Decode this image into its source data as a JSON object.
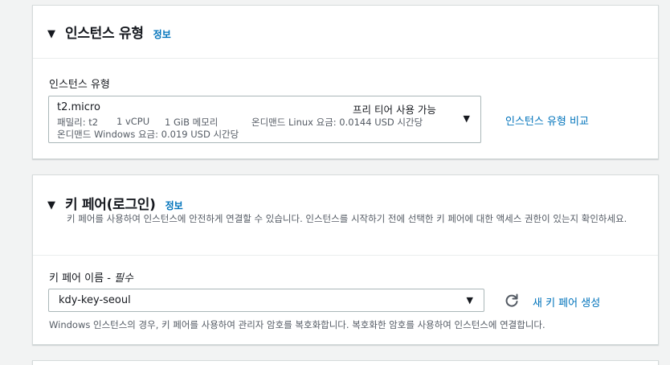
{
  "instance_type_panel": {
    "title": "인스턴스 유형",
    "info": "정보",
    "field_label": "인스턴스 유형",
    "selected": {
      "name": "t2.micro",
      "tag": "프리 티어 사용 가능",
      "family": "패밀리: t2",
      "vcpu": "1 vCPU",
      "memory": "1 GiB 메모리",
      "linux_price": "온디맨드 Linux 요금: 0.0144 USD 시간당",
      "windows_price": "온디맨드 Windows 요금: 0.019 USD 시간당"
    },
    "compare_link": "인스턴스 유형 비교"
  },
  "key_pair_panel": {
    "title": "키 페어(로그인)",
    "info": "정보",
    "description": "키 페어를 사용하여 인스턴스에 안전하게 연결할 수 있습니다. 인스턴스를 시작하기 전에 선택한 키 페어에 대한 액세스 권한이 있는지 확인하세요.",
    "field_label": "키 페어 이름 - ",
    "required": "필수",
    "selected_value": "kdy-key-seoul",
    "create_link": "새 키 페어 생성",
    "help_text": "Windows 인스턴스의 경우, 키 페어를 사용하여 관리자 암호를 복호화합니다. 복호화한 암호를 사용하여 인스턴스에 연결합니다."
  },
  "icons": {
    "expand": "caret-down-icon",
    "dropdown": "caret-down-icon",
    "refresh": "refresh-icon"
  },
  "colors": {
    "link": "#0073bb",
    "background": "#f2f3f3",
    "border": "#aab7b8"
  }
}
